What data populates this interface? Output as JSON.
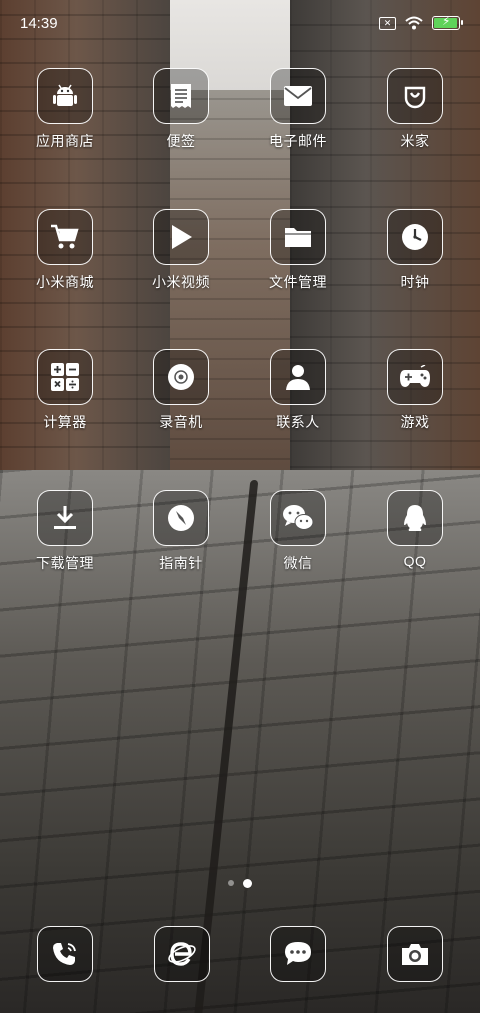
{
  "status_bar": {
    "time": "14:39",
    "icons": [
      "no-sim-icon",
      "wifi-icon",
      "battery-charging-icon"
    ],
    "battery_color": "#5fd35a"
  },
  "apps": [
    {
      "label": "应用商店",
      "icon": "android-icon"
    },
    {
      "label": "便签",
      "icon": "notes-icon"
    },
    {
      "label": "电子邮件",
      "icon": "mail-icon"
    },
    {
      "label": "米家",
      "icon": "mijia-icon"
    },
    {
      "label": "小米商城",
      "icon": "cart-icon"
    },
    {
      "label": "小米视频",
      "icon": "play-icon"
    },
    {
      "label": "文件管理",
      "icon": "folder-icon"
    },
    {
      "label": "时钟",
      "icon": "clock-icon"
    },
    {
      "label": "计算器",
      "icon": "calculator-icon"
    },
    {
      "label": "录音机",
      "icon": "recorder-icon"
    },
    {
      "label": "联系人",
      "icon": "contact-icon"
    },
    {
      "label": "游戏",
      "icon": "gamepad-icon"
    },
    {
      "label": "下载管理",
      "icon": "download-icon"
    },
    {
      "label": "指南针",
      "icon": "compass-icon"
    },
    {
      "label": "微信",
      "icon": "wechat-icon"
    },
    {
      "label": "QQ",
      "icon": "qq-icon"
    }
  ],
  "pager": {
    "pages": 2,
    "active_page": 2
  },
  "dock": [
    {
      "icon": "phone-icon"
    },
    {
      "icon": "browser-icon"
    },
    {
      "icon": "messages-icon"
    },
    {
      "icon": "camera-icon"
    }
  ]
}
